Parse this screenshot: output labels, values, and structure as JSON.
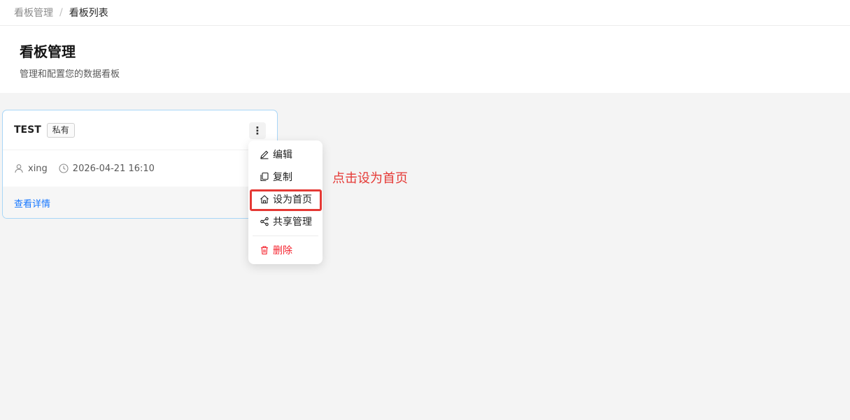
{
  "breadcrumb": {
    "parent": "看板管理",
    "separator": "/",
    "current": "看板列表"
  },
  "header": {
    "title": "看板管理",
    "description": "管理和配置您的数据看板"
  },
  "card": {
    "name": "TEST",
    "tag": "私有",
    "more_icon": "⋮",
    "owner": "xing",
    "timestamp": "2026-04-21 16:10",
    "view_link": "查看详情",
    "border_color": "#a8d6f7"
  },
  "menu": {
    "items": [
      {
        "label": "编辑",
        "icon": "edit-icon"
      },
      {
        "label": "复制",
        "icon": "copy-icon"
      },
      {
        "label": "设为首页",
        "icon": "home-icon"
      },
      {
        "label": "共享管理",
        "icon": "share-icon"
      }
    ],
    "danger_item": {
      "label": "删除",
      "icon": "delete-icon"
    }
  },
  "annotation": {
    "text": "点击设为首页",
    "color": "#e53935"
  }
}
